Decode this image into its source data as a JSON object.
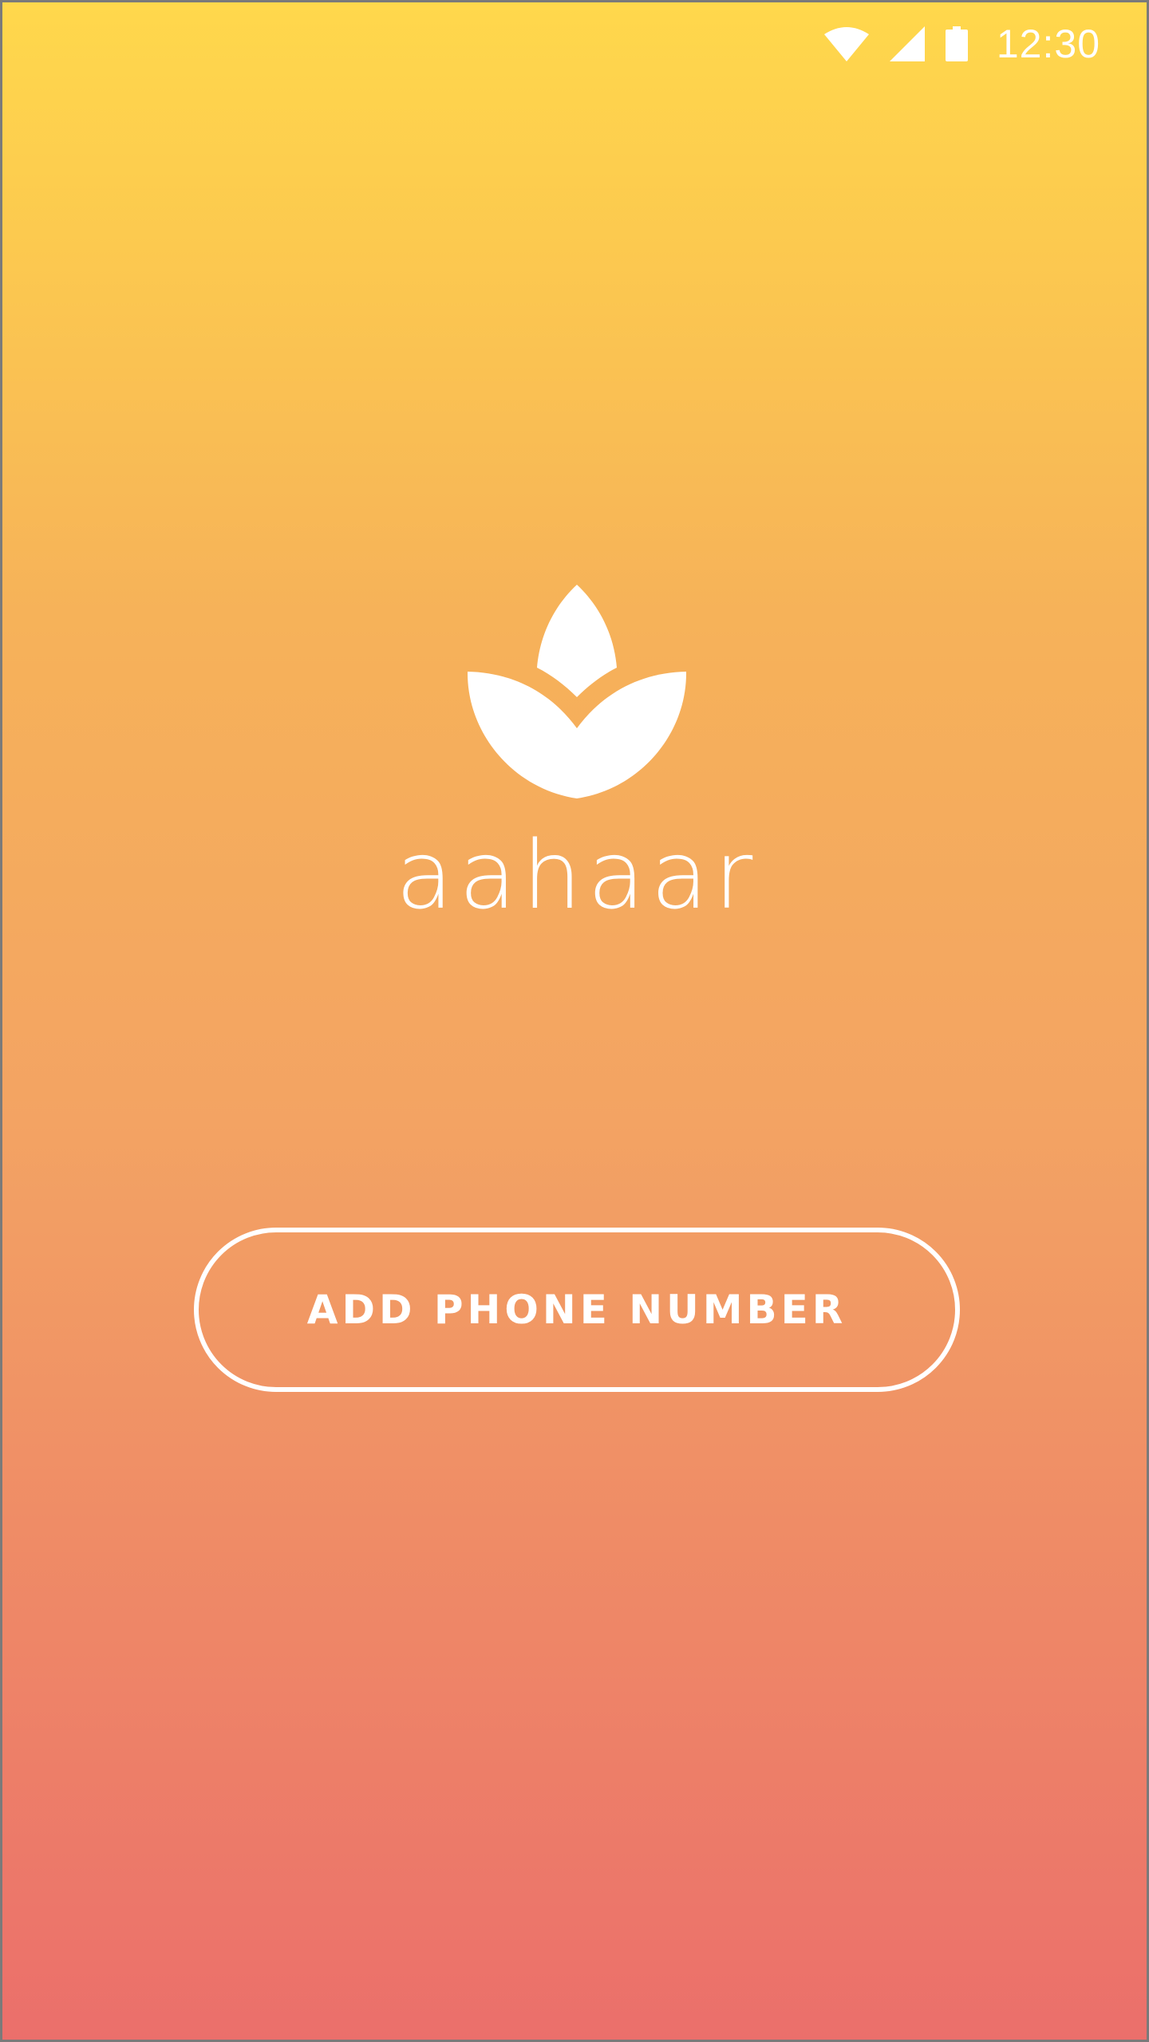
{
  "status_bar": {
    "time": "12:30",
    "icons": [
      "wifi-icon",
      "cell-signal-icon",
      "battery-icon"
    ]
  },
  "app": {
    "name": "aahaar",
    "logo": "lotus-leaf-logo"
  },
  "actions": {
    "add_phone_label": "ADD PHONE NUMBER"
  },
  "colors": {
    "gradient_top": "#FFD84C",
    "gradient_bottom": "#EB6F6B",
    "foreground": "#FFFFFF"
  }
}
